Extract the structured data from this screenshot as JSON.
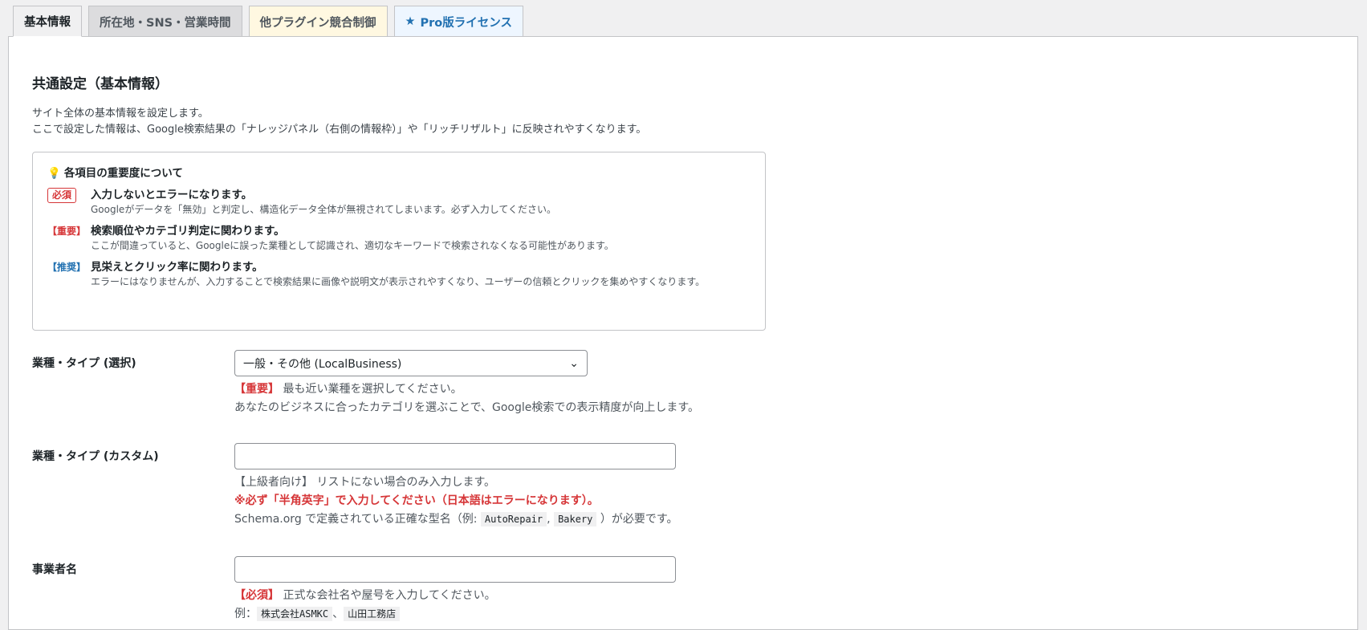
{
  "tabs": [
    {
      "label": "基本情報"
    },
    {
      "label": "所在地・SNS・営業時間"
    },
    {
      "label": "他プラグイン競合制御"
    },
    {
      "label": "Pro版ライセンス",
      "icon": "star-icon"
    }
  ],
  "section": {
    "title": "共通設定（基本情報）",
    "intro": [
      "サイト全体の基本情報を設定します。",
      "ここで設定した情報は、Google検索結果の「ナレッジパネル（右側の情報枠）」や「リッチリザルト」に反映されやすくなります。"
    ]
  },
  "notice": {
    "title": "各項目の重要度について",
    "items": [
      {
        "badge": "必須",
        "title": "入力しないとエラーになります。",
        "desc": "Googleがデータを「無効」と判定し、構造化データ全体が無視されてしまいます。必ず入力してください。"
      },
      {
        "badge": "【重要】",
        "title": "検索順位やカテゴリ判定に関わります。",
        "desc": "ここが間違っていると、Googleに誤った業種として認識され、適切なキーワードで検索されなくなる可能性があります。"
      },
      {
        "badge": "【推奨】",
        "title": "見栄えとクリック率に関わります。",
        "desc": "エラーにはなりませんが、入力することで検索結果に画像や説明文が表示されやすくなり、ユーザーの信頼とクリックを集めやすくなります。"
      }
    ]
  },
  "fields": {
    "type_select": {
      "label": "業種・タイプ (選択)",
      "value": "一般・その他 (LocalBusiness)",
      "tag": "【重要】",
      "hint1": "最も近い業種を選択してください。",
      "hint2": "あなたのビジネスに合ったカテゴリを選ぶことで、Google検索での表示精度が向上します。"
    },
    "type_custom": {
      "label": "業種・タイプ (カスタム)",
      "value": "",
      "hint1": "【上級者向け】 リストにない場合のみ入力します。",
      "warn": "※必ず「半角英字」で入力してください（日本語はエラーになります）。",
      "hint3a": "Schema.org で定義されている正確な型名（例: ",
      "code1": "AutoRepair",
      "sep": ", ",
      "code2": "Bakery",
      "hint3b": " ）が必要です。"
    },
    "business_name": {
      "label": "事業者名",
      "value": "",
      "tag": "【必須】",
      "hint1": "正式な会社名や屋号を入力してください。",
      "ex": "例：",
      "ex1": "株式会社ASMKC",
      "exsep": "、",
      "ex2": "山田工務店"
    }
  }
}
